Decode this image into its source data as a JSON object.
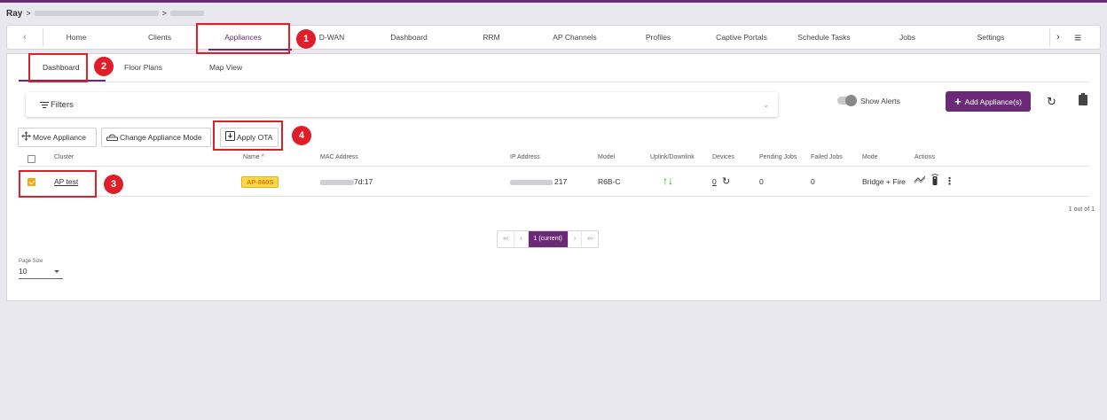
{
  "breadcrumb": {
    "root": "Ray",
    "sep": ">",
    "sep2": ">"
  },
  "nav": {
    "prev": "‹",
    "items": [
      {
        "label": "Home"
      },
      {
        "label": "Clients"
      },
      {
        "label": "Appliances",
        "active": true
      },
      {
        "label": "D-WAN"
      },
      {
        "label": "Dashboard"
      },
      {
        "label": "RRM"
      },
      {
        "label": "AP Channels"
      },
      {
        "label": "Profiles"
      },
      {
        "label": "Captive Portals"
      },
      {
        "label": "Schedule Tasks"
      },
      {
        "label": "Jobs"
      },
      {
        "label": "Settings"
      }
    ],
    "next": "›",
    "menu_icon": "≡"
  },
  "subtabs": [
    {
      "label": "Dashboard",
      "active": true
    },
    {
      "label": "Floor Plans"
    },
    {
      "label": "Map View"
    }
  ],
  "filters": {
    "label": "Filters",
    "chevron": "⌄"
  },
  "show_alerts": "Show Alerts",
  "add_button": {
    "icon": "+",
    "label": "Add Appliance(s)"
  },
  "actions": {
    "move": "Move Appliance",
    "change_mode": "Change Appliance Mode",
    "apply_ota": "Apply OTA"
  },
  "table": {
    "headers": [
      "Cluster",
      "Name ^",
      "MAC Address",
      "IP Address",
      "Model",
      "Uplink/Downlink",
      "Devices",
      "Pending Jobs",
      "Failed Jobs",
      "Mode",
      "Actions"
    ],
    "rows": [
      {
        "checked": true,
        "cluster": "AP test",
        "name": "AP-860S",
        "mac": "7d:17",
        "ip": "217",
        "model": "R6B-C",
        "uplink": "↑↓",
        "devices": "0",
        "pending": "0",
        "failed": "0",
        "mode": "Bridge + Fire"
      }
    ]
  },
  "count_text": "1 out of 1",
  "pagination": {
    "first": "«‹",
    "prev": "‹",
    "current": "1 (current)",
    "next": "›",
    "last": "»›"
  },
  "page_size": {
    "label": "Page Size",
    "value": "10"
  },
  "annotations": [
    "1",
    "2",
    "3",
    "4"
  ],
  "colors": {
    "accent": "#6b2a78",
    "highlight": "#e01e2a",
    "checkbox": "#f0a818"
  }
}
